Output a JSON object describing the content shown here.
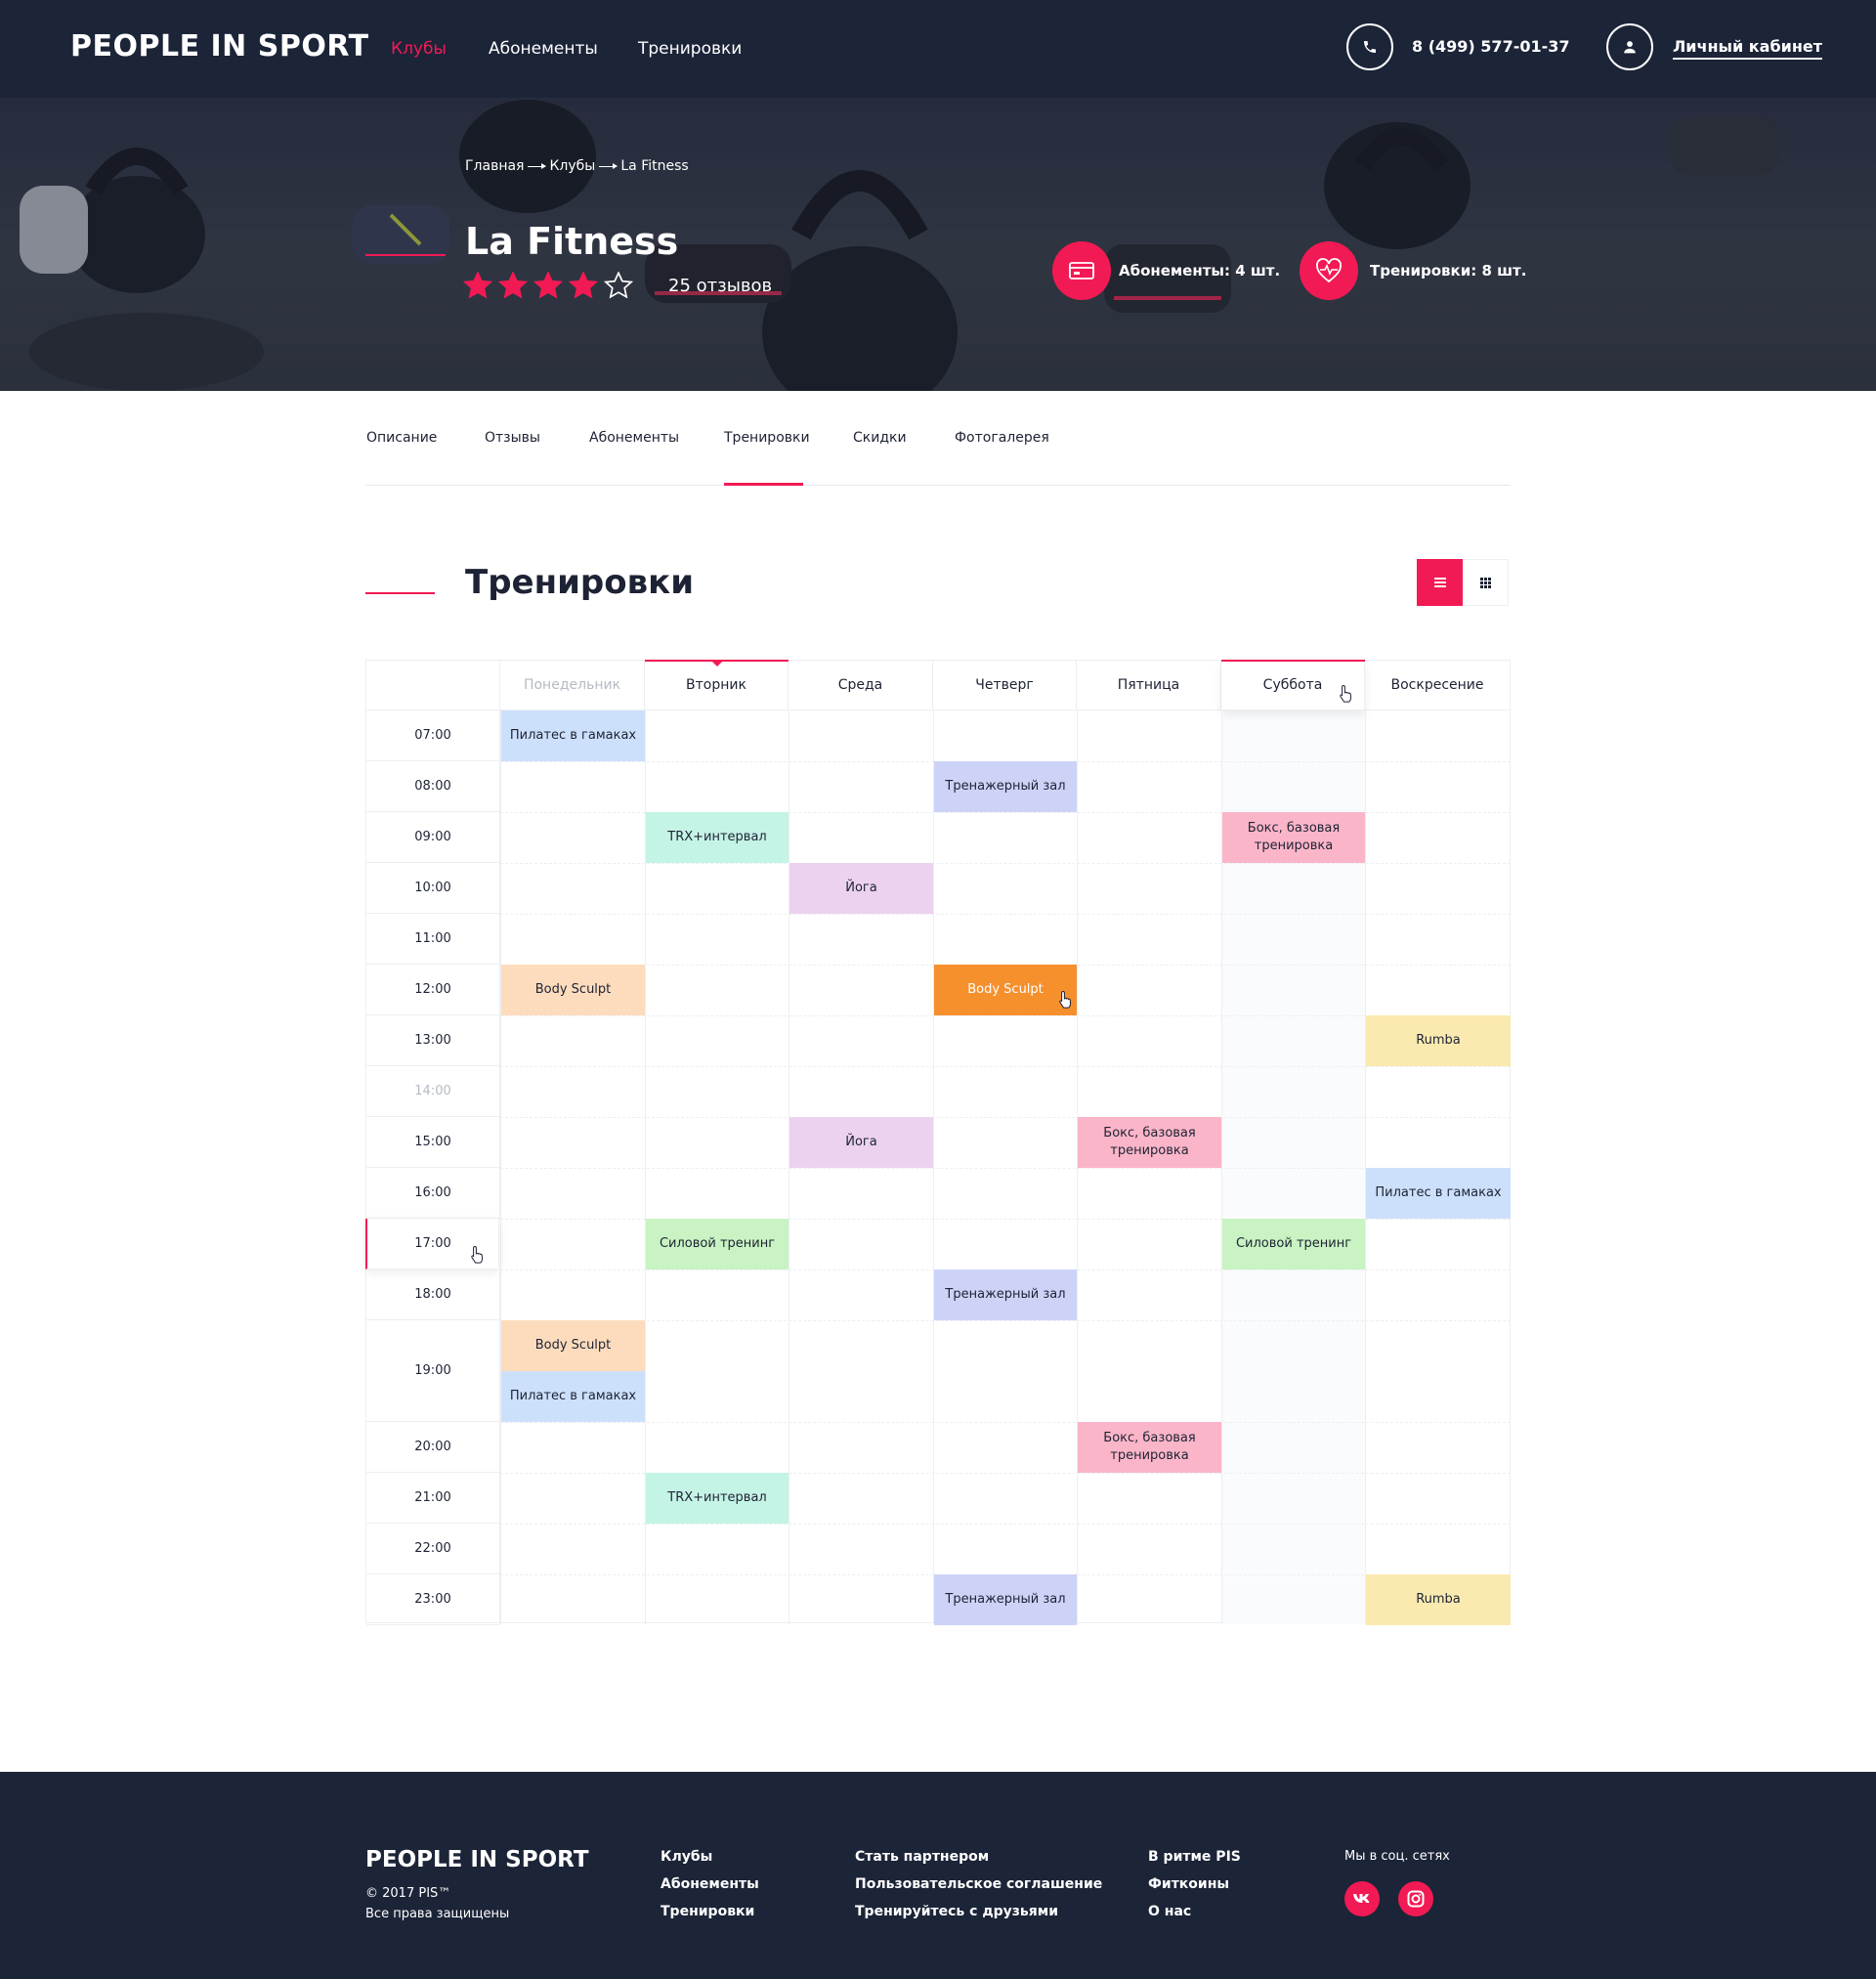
{
  "header": {
    "logo": "PEOPLE IN SPORT",
    "nav": [
      "Клубы",
      "Абонементы",
      "Тренировки"
    ],
    "phone": "8 (499) 577-01-37",
    "cabinet": "Личный кабинет"
  },
  "hero": {
    "breadcrumb": [
      "Главная",
      "Клубы",
      "La Fitness"
    ],
    "title": "La Fitness",
    "rating": 4,
    "reviews": "25 отзывов",
    "stats": {
      "subscriptions": "Абонементы: 4 шт.",
      "trainings": "Тренировки: 8 шт."
    }
  },
  "tabs": [
    "Описание",
    "Отзывы",
    "Абонементы",
    "Тренировки",
    "Скидки",
    "Фотогалерея"
  ],
  "active_tab": "Тренировки",
  "section_title": "Тренировки",
  "schedule": {
    "days": [
      "Понедельник",
      "Вторник",
      "Среда",
      "Четверг",
      "Пятница",
      "Суббота",
      "Воскресение"
    ],
    "times": [
      "07:00",
      "08:00",
      "09:00",
      "10:00",
      "11:00",
      "12:00",
      "13:00",
      "14:00",
      "15:00",
      "16:00",
      "17:00",
      "18:00",
      "19:00",
      "20:00",
      "21:00",
      "22:00",
      "23:00"
    ],
    "events": [
      {
        "day": "Понедельник",
        "time": "07:00",
        "name": "Пилатес в гамаках",
        "color": "#cde0fb"
      },
      {
        "day": "Четверг",
        "time": "08:00",
        "name": "Тренажерный зал",
        "color": "#cdd3f7"
      },
      {
        "day": "Вторник",
        "time": "09:00",
        "name": "TRX+интервал",
        "color": "#c4f4e6"
      },
      {
        "day": "Суббота",
        "time": "09:00",
        "name": "Бокс, базовая тренировка",
        "color": "#fbb5c9"
      },
      {
        "day": "Среда",
        "time": "10:00",
        "name": "Йога",
        "color": "#ecd2ee"
      },
      {
        "day": "Понедельник",
        "time": "12:00",
        "name": "Body Sculpt",
        "color": "#fddcbd"
      },
      {
        "day": "Четверг",
        "time": "12:00",
        "name": "Body Sculpt",
        "color": "#f6902d",
        "selected": true
      },
      {
        "day": "Воскресение",
        "time": "13:00",
        "name": "Rumba",
        "color": "#fbeab0"
      },
      {
        "day": "Среда",
        "time": "15:00",
        "name": "Йога",
        "color": "#ecd2ee"
      },
      {
        "day": "Пятница",
        "time": "15:00",
        "name": "Бокс, базовая тренировка",
        "color": "#fbb5c9"
      },
      {
        "day": "Воскресение",
        "time": "16:00",
        "name": "Пилатес в гамаках",
        "color": "#cde0fb"
      },
      {
        "day": "Вторник",
        "time": "17:00",
        "name": "Силовой тренинг",
        "color": "#c9f3c3"
      },
      {
        "day": "Суббота",
        "time": "17:00",
        "name": "Силовой тренинг",
        "color": "#c9f3c3"
      },
      {
        "day": "Четверг",
        "time": "18:00",
        "name": "Тренажерный зал",
        "color": "#cdd3f7"
      },
      {
        "day": "Понедельник",
        "time": "19:00",
        "name": "Body Sculpt",
        "color": "#fddcbd",
        "slot": 0
      },
      {
        "day": "Понедельник",
        "time": "19:00",
        "name": "Пилатес в гамаках",
        "color": "#cde0fb",
        "slot": 1
      },
      {
        "day": "Пятница",
        "time": "20:00",
        "name": "Бокс, базовая тренировка",
        "color": "#fbb5c9"
      },
      {
        "day": "Вторник",
        "time": "21:00",
        "name": "TRX+интервал",
        "color": "#c4f4e6"
      },
      {
        "day": "Четверг",
        "time": "23:00",
        "name": "Тренажерный зал",
        "color": "#cdd3f7"
      },
      {
        "day": "Воскресение",
        "time": "23:00",
        "name": "Rumba",
        "color": "#fbeab0"
      }
    ]
  },
  "footer": {
    "logo": "PEOPLE IN SPORT",
    "copyright": "© 2017 PIS™",
    "rights": "Все права защищены",
    "col1": [
      "Клубы",
      "Абонементы",
      "Тренировки"
    ],
    "col2": [
      "Стать партнером",
      "Пользовательское соглашение",
      "Тренируйтесь с друзьями"
    ],
    "col3": [
      "В ритме PIS",
      "Фиткоины",
      "О нас"
    ],
    "social_title": "Мы в соц. сетях",
    "social": [
      "vk-icon",
      "instagram-icon"
    ]
  },
  "colors": {
    "accent": "#f21a54",
    "navy": "#1c2438"
  }
}
